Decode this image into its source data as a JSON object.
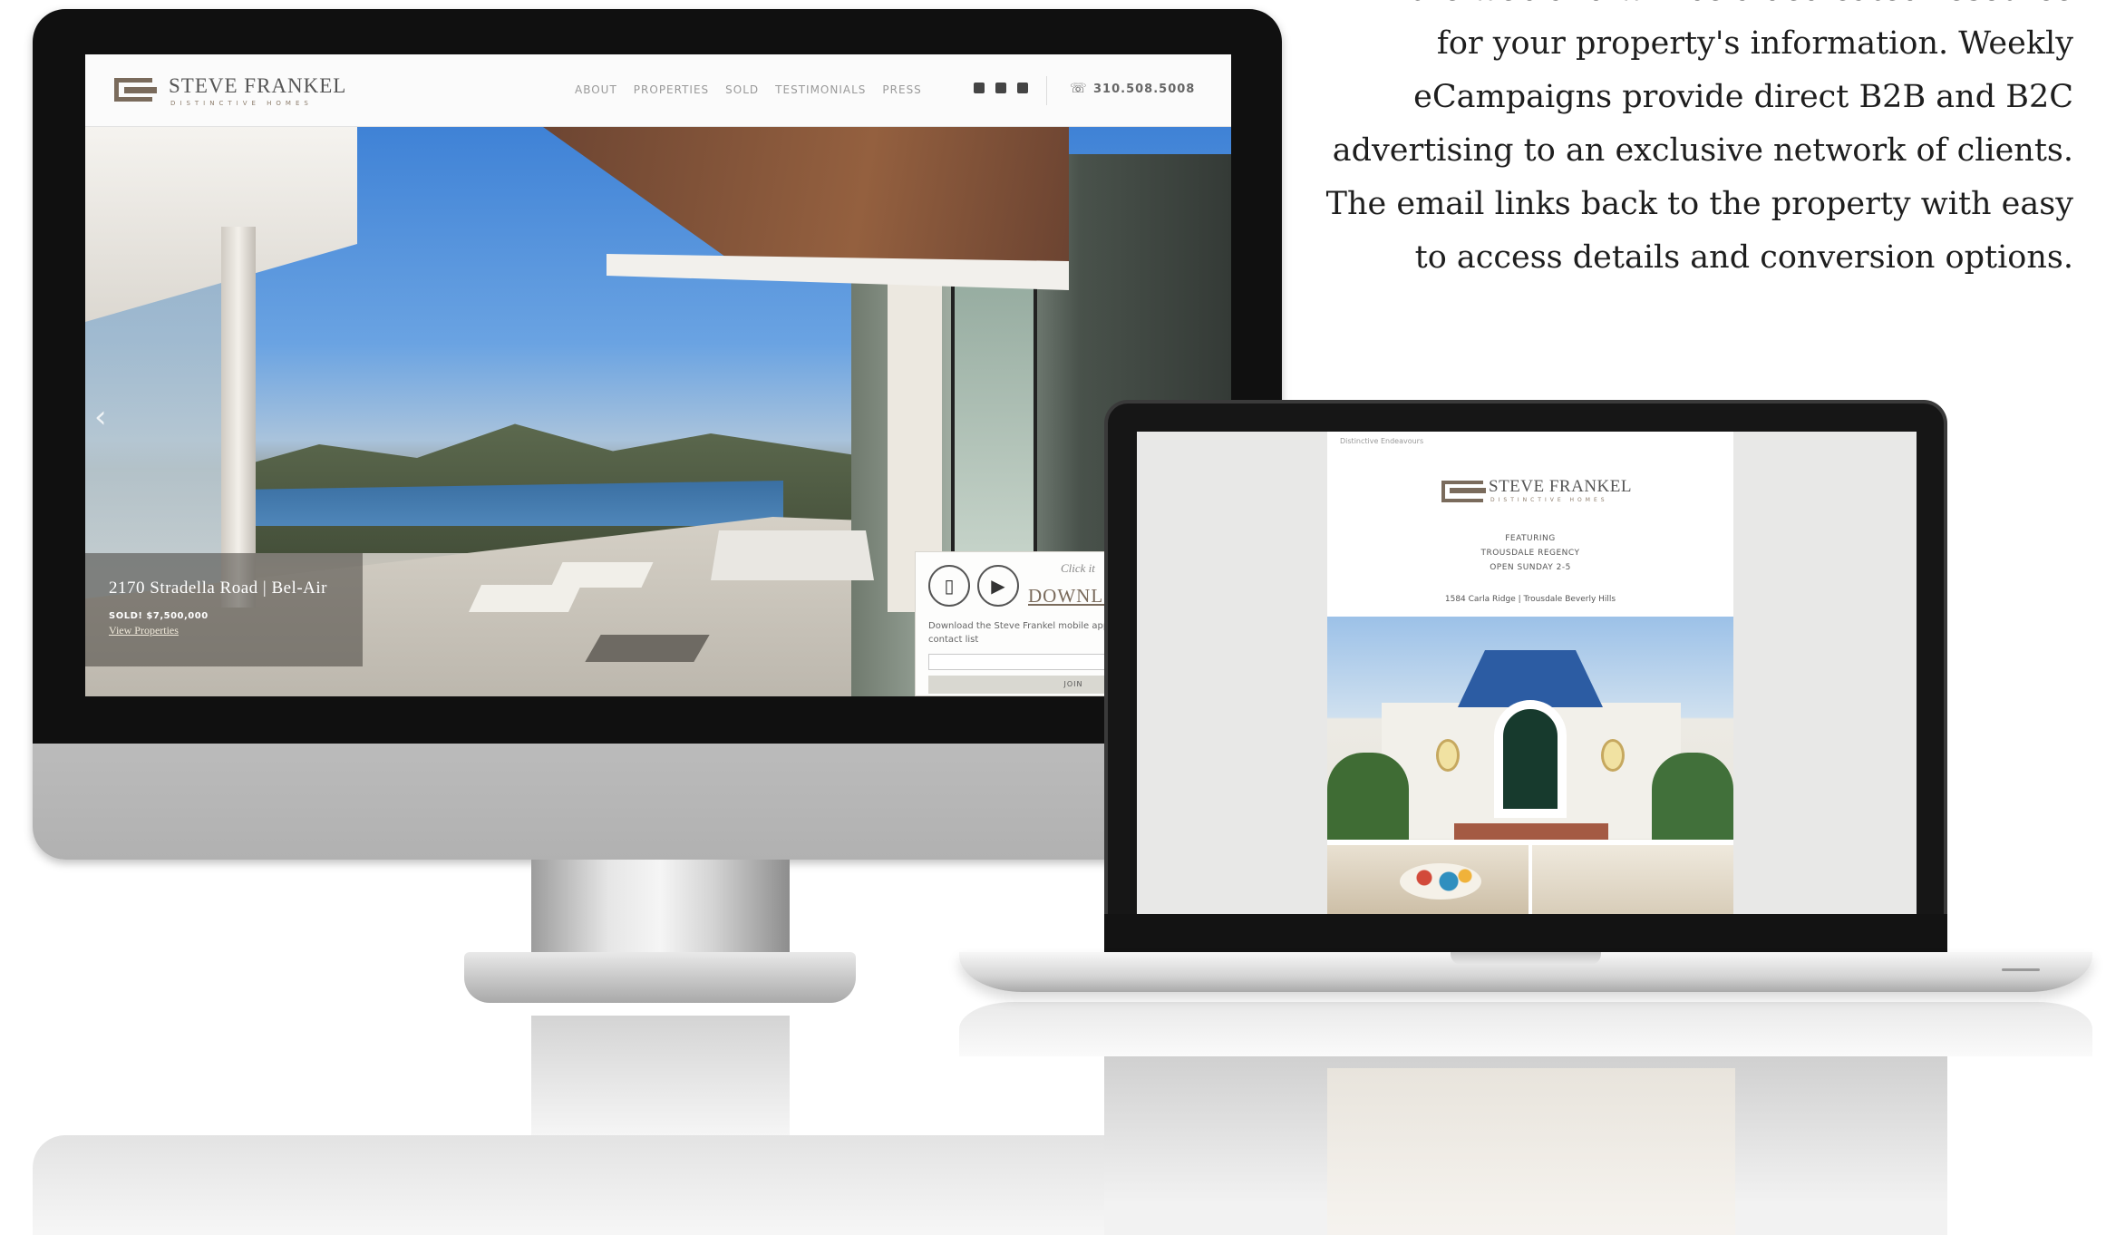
{
  "intro_text": {
    "lines": [
      "the web and will be a dedicated resource",
      "for your property's information. Weekly",
      "eCampaigns provide direct B2B and B2C",
      "advertising to an exclusive network of clients.",
      "The email links back to the property with easy",
      "to access details and conversion options."
    ]
  },
  "website": {
    "logo": {
      "name": "STEVE FRANKEL",
      "tagline": "DISTINCTIVE HOMES"
    },
    "nav": [
      "ABOUT",
      "PROPERTIES",
      "SOLD",
      "TESTIMONIALS",
      "PRESS"
    ],
    "social_icons": [
      "instagram-icon",
      "pinterest-icon",
      "facebook-icon"
    ],
    "phone_icon": "phone-icon",
    "phone": "310.508.5008",
    "hero": {
      "prev_arrow": "‹",
      "caption_title": "2170 Stradella Road | Bel-Air",
      "caption_sold": "SOLD! $7,500,000",
      "caption_link": "View Properties"
    },
    "download_box": {
      "click_text": "Click it",
      "title": "DOWNLOAD",
      "text": "Download the Steve Frankel mobile app & sign up for our email contact list",
      "input_placeholder": "",
      "button_label": "JOIN",
      "phone_glyph": "▯",
      "play_glyph": "▶"
    }
  },
  "email": {
    "preheader": "Distinctive Endeavours",
    "logo": {
      "name": "STEVE FRANKEL",
      "tagline": "DISTINCTIVE HOMES"
    },
    "lines": [
      "FEATURING",
      "TROUSDALE REGENCY",
      "OPEN SUNDAY 2-5"
    ],
    "address": "1584 Carla Ridge | Trousdale Beverly Hills"
  }
}
